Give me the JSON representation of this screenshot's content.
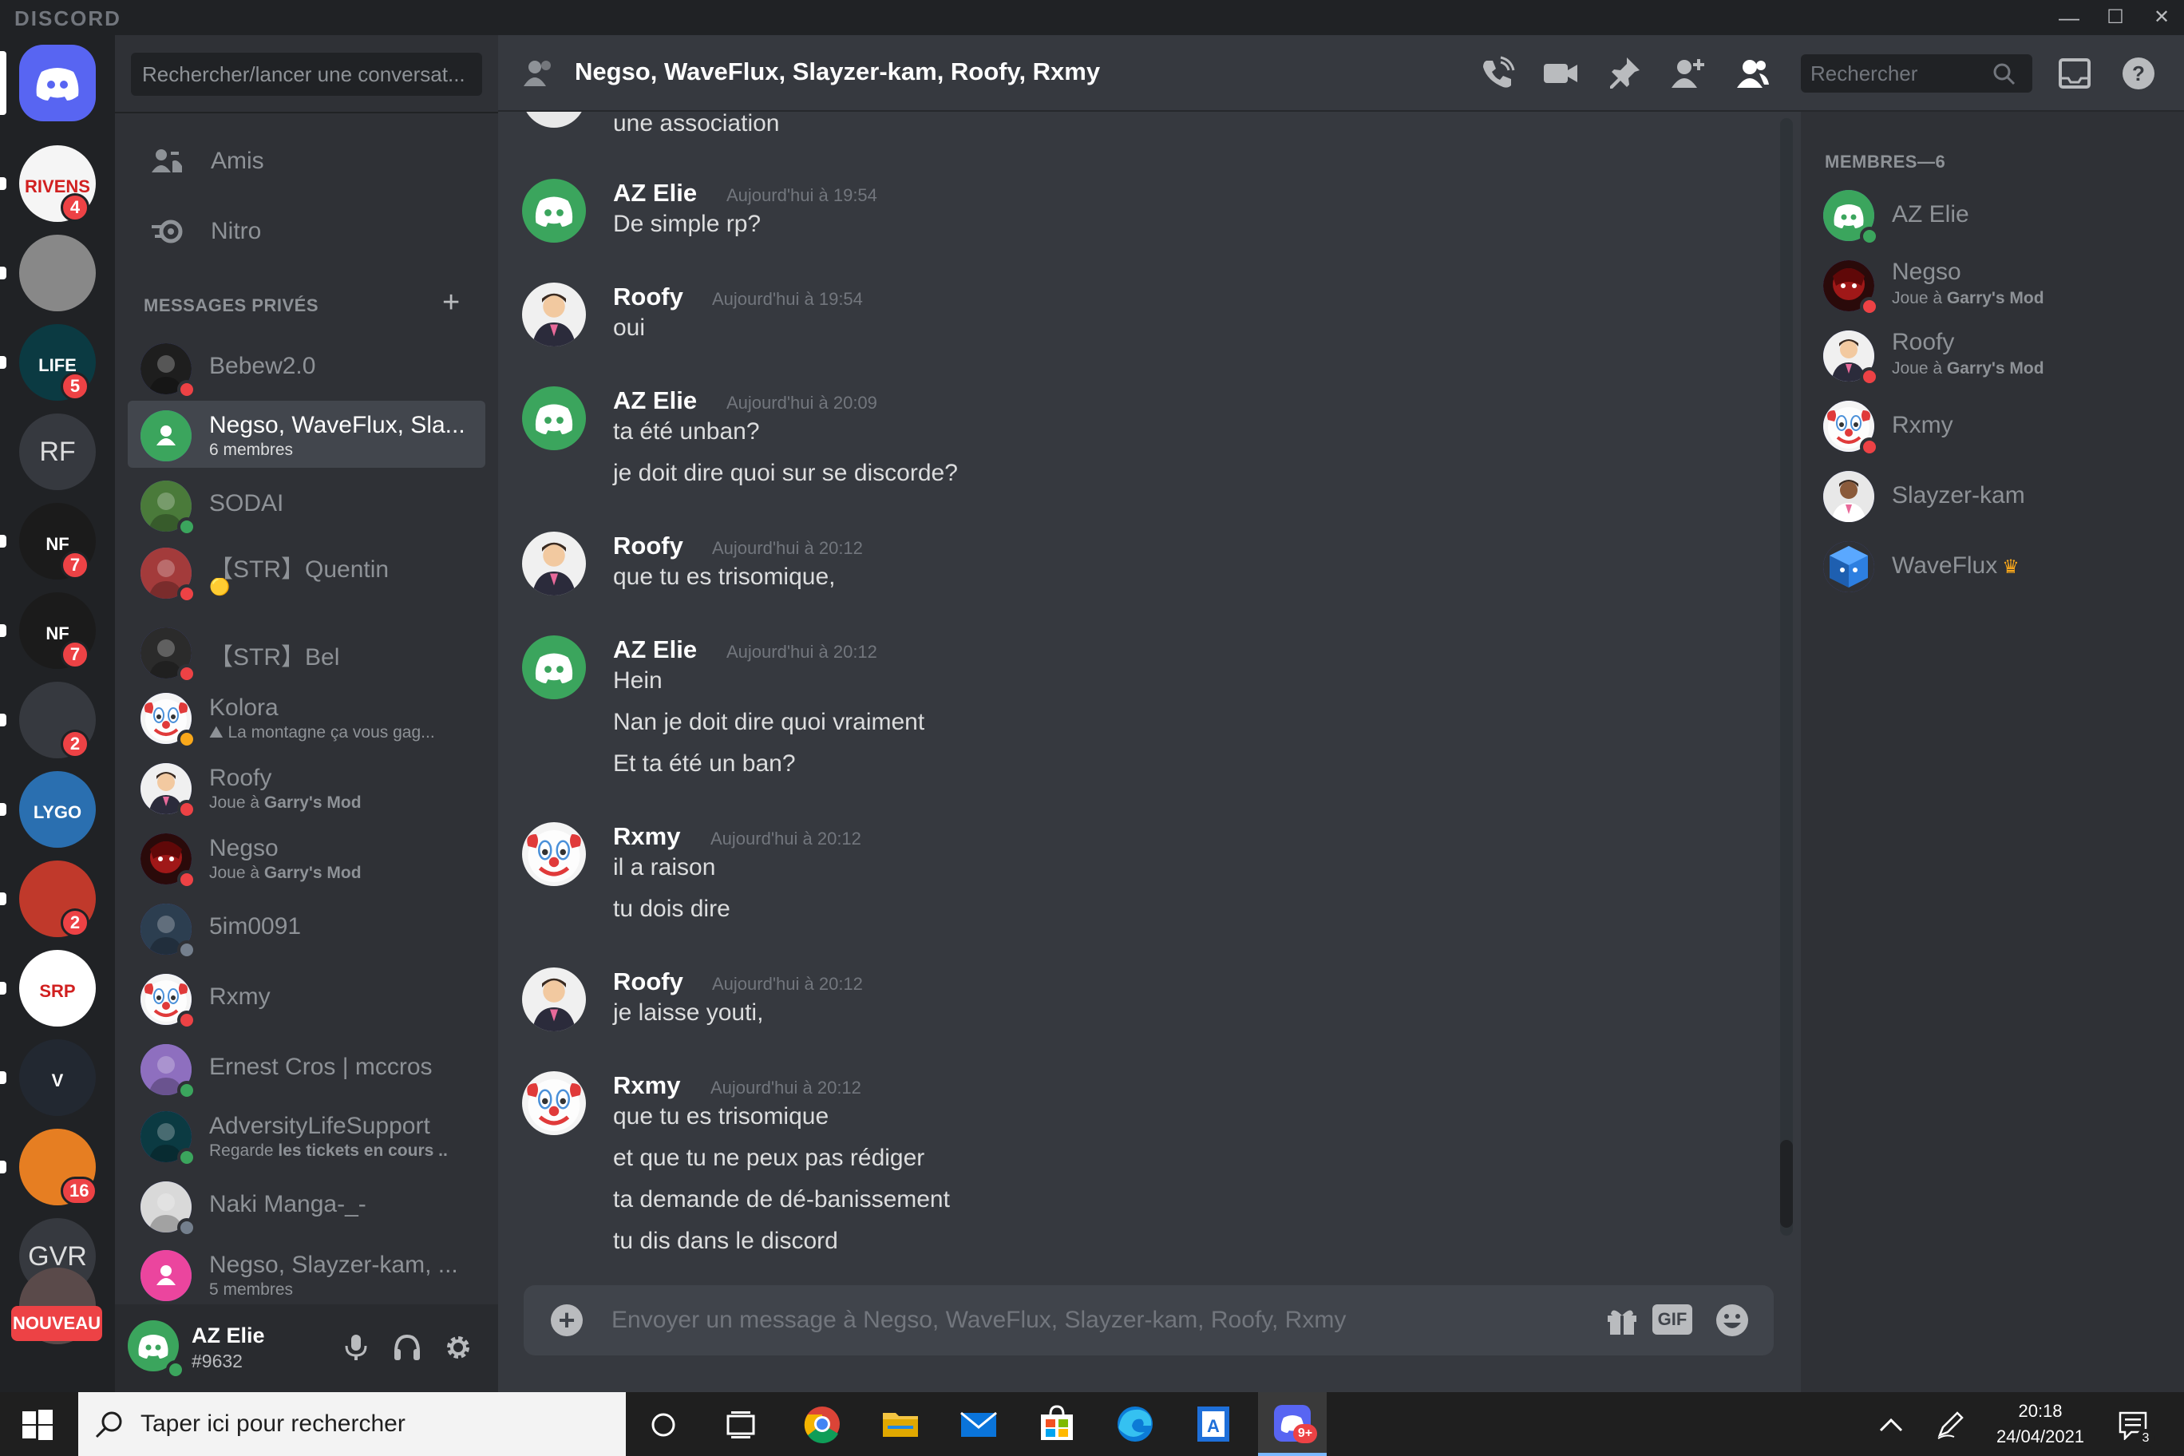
{
  "window": {
    "brand": "DISCORD",
    "minimize": "—",
    "maximize": "☐",
    "close": "✕"
  },
  "servers": [
    {
      "kind": "home",
      "name": "discord-home"
    },
    {
      "kind": "image",
      "name": "Rivens",
      "label": "RIVENS",
      "badge": "4",
      "color": "#f5f5f5"
    },
    {
      "kind": "image",
      "name": "photo-server",
      "color": "#888888"
    },
    {
      "kind": "image",
      "name": "adversity-life",
      "label": "LIFE",
      "badge": "5",
      "color": "#0b3a42"
    },
    {
      "kind": "text",
      "name": "RF",
      "label": "RF"
    },
    {
      "kind": "image",
      "name": "nf-server-1",
      "label": "NF",
      "badge": "7",
      "color": "#1b1b1b"
    },
    {
      "kind": "image",
      "name": "nf-server-2",
      "label": "NF",
      "badge": "7",
      "color": "#1b1b1b"
    },
    {
      "kind": "image",
      "name": "apple-server",
      "badge": "2",
      "color": "#36393f"
    },
    {
      "kind": "image",
      "name": "lygo",
      "label": "LYGO",
      "color": "#2a6fb0"
    },
    {
      "kind": "image",
      "name": "red-char-server",
      "badge": "2",
      "color": "#c0392b"
    },
    {
      "kind": "image",
      "name": "srp",
      "label": "SRP",
      "color": "#ffffff"
    },
    {
      "kind": "image",
      "name": "gta-v",
      "label": "V",
      "color": "#222831"
    },
    {
      "kind": "image",
      "name": "sunset-server",
      "badge": "16",
      "color": "#e67e22"
    },
    {
      "kind": "text",
      "name": "GVR",
      "label": "GVR"
    },
    {
      "kind": "new",
      "name": "nouveau",
      "label": "NOUVEAU"
    }
  ],
  "dm_sidebar": {
    "search_placeholder": "Rechercher/lancer une conversat...",
    "nav": [
      {
        "label": "Amis",
        "icon": "friends-icon"
      },
      {
        "label": "Nitro",
        "icon": "nitro-icon"
      }
    ],
    "section_title": "MESSAGES PRIVÉS",
    "dms": [
      {
        "name": "Bebew2.0",
        "sub": "",
        "status": "dnd",
        "avcolor": "#1e1e1e",
        "active": false
      },
      {
        "name": "Negso, WaveFlux, Sla...",
        "sub": "6 membres",
        "status": "",
        "avcolor": "#3ba55d",
        "active": true,
        "group": true
      },
      {
        "name": "SODAI",
        "sub": "",
        "status": "mobile",
        "avcolor": "#4a7a3a",
        "active": false
      },
      {
        "name": "【STR】Quentin",
        "sub": "🟡",
        "status": "dnd",
        "avcolor": "#a33b3b",
        "active": false
      },
      {
        "name": "【STR】Bel",
        "sub": "",
        "status": "dnd",
        "avcolor": "#2b2b2b",
        "active": false
      },
      {
        "name": "Kolora",
        "sub_pre": "⛰ ",
        "sub": "La montagne ça vous gag...",
        "status": "idle",
        "avcolor": "#f2f2f2",
        "active": false
      },
      {
        "name": "Roofy",
        "sub_pre": "Joue à ",
        "sub_bold": "Garry's Mod",
        "status": "dnd",
        "avcolor": "#e8e8e8",
        "active": false
      },
      {
        "name": "Negso",
        "sub_pre": "Joue à ",
        "sub_bold": "Garry's Mod",
        "status": "dnd",
        "avcolor": "#7a1010",
        "active": false
      },
      {
        "name": "5im0091",
        "sub": "",
        "status": "offline",
        "avcolor": "#2c3e50",
        "active": false
      },
      {
        "name": "Rxmy",
        "sub": "",
        "status": "dnd",
        "avcolor": "#f2f2f2",
        "active": false
      },
      {
        "name": "Ernest Cros | mccros",
        "sub": "",
        "status": "online",
        "avcolor": "#8e6fbf",
        "active": false
      },
      {
        "name": "AdversityLifeSupport",
        "sub_pre": "Regarde ",
        "sub_bold": "les tickets en cours ..",
        "status": "online",
        "avcolor": "#0b3a42",
        "active": false
      },
      {
        "name": "Naki Manga-_-",
        "sub": "",
        "status": "offline",
        "avcolor": "#d9d9d9",
        "active": false
      },
      {
        "name": "Negso, Slayzer-kam, ...",
        "sub": "5 membres",
        "status": "",
        "avcolor": "#eb459e",
        "active": false,
        "group": true
      }
    ]
  },
  "user_panel": {
    "name": "AZ Elie",
    "tag": "#9632"
  },
  "chat": {
    "title": "Negso, WaveFlux, Slayzer-kam, Roofy, Rxmy",
    "search_placeholder": "Rechercher",
    "partial_top_line": "une association",
    "messages": [
      {
        "author": "AZ Elie",
        "time": "Aujourd'hui à 19:54",
        "avatar": "discord",
        "lines": [
          "De simple rp?"
        ]
      },
      {
        "author": "Roofy",
        "time": "Aujourd'hui à 19:54",
        "avatar": "roofy",
        "lines": [
          "oui"
        ]
      },
      {
        "author": "AZ Elie",
        "time": "Aujourd'hui à 20:09",
        "avatar": "discord",
        "lines": [
          "ta été unban?",
          "je doit dire quoi sur se discorde?"
        ]
      },
      {
        "author": "Roofy",
        "time": "Aujourd'hui à 20:12",
        "avatar": "roofy",
        "lines": [
          "que tu es trisomique,"
        ]
      },
      {
        "author": "AZ Elie",
        "time": "Aujourd'hui à 20:12",
        "avatar": "discord",
        "lines": [
          "Hein",
          "Nan je doit dire quoi vraiment",
          "Et ta été un ban?"
        ]
      },
      {
        "author": "Rxmy",
        "time": "Aujourd'hui à 20:12",
        "avatar": "clown",
        "lines": [
          "il a raison",
          "tu dois dire"
        ]
      },
      {
        "author": "Roofy",
        "time": "Aujourd'hui à 20:12",
        "avatar": "roofy",
        "lines": [
          "je laisse youti,"
        ]
      },
      {
        "author": "Rxmy",
        "time": "Aujourd'hui à 20:12",
        "avatar": "clown",
        "lines": [
          "que tu es trisomique",
          "et que tu ne peux pas rédiger",
          "ta demande de dé-banissement",
          "tu dis dans le discord"
        ]
      }
    ],
    "composer_placeholder": "Envoyer un message à Negso, WaveFlux, Slayzer-kam, Roofy, Rxmy",
    "gif_label": "GIF",
    "plus_label": "+"
  },
  "members": {
    "title": "MEMBRES—6",
    "list": [
      {
        "name": "AZ Elie",
        "sub_pre": "",
        "sub_bold": "",
        "status": "online",
        "avatar": "discord"
      },
      {
        "name": "Negso",
        "sub_pre": "Joue à ",
        "sub_bold": "Garry's Mod",
        "status": "dnd",
        "avatar": "negso"
      },
      {
        "name": "Roofy",
        "sub_pre": "Joue à ",
        "sub_bold": "Garry's Mod",
        "status": "dnd",
        "avatar": "roofy"
      },
      {
        "name": "Rxmy",
        "sub_pre": "",
        "sub_bold": "",
        "status": "dnd",
        "avatar": "clown"
      },
      {
        "name": "Slayzer-kam",
        "sub_pre": "",
        "sub_bold": "",
        "status": "",
        "avatar": "slayzer"
      },
      {
        "name": "WaveFlux",
        "sub_pre": "",
        "sub_bold": "",
        "status": "",
        "avatar": "waveflux",
        "owner": true
      }
    ]
  },
  "taskbar": {
    "search_placeholder": "Taper ici pour rechercher",
    "time": "20:18",
    "date": "24/04/2021",
    "notif_count": "3",
    "discord_badge": "9+"
  },
  "colors": {
    "online": "#3ba55d",
    "dnd": "#ed4245",
    "idle": "#faa81a",
    "offline": "#747f8d",
    "blurple": "#5865f2",
    "discord_green": "#3ba55d"
  }
}
